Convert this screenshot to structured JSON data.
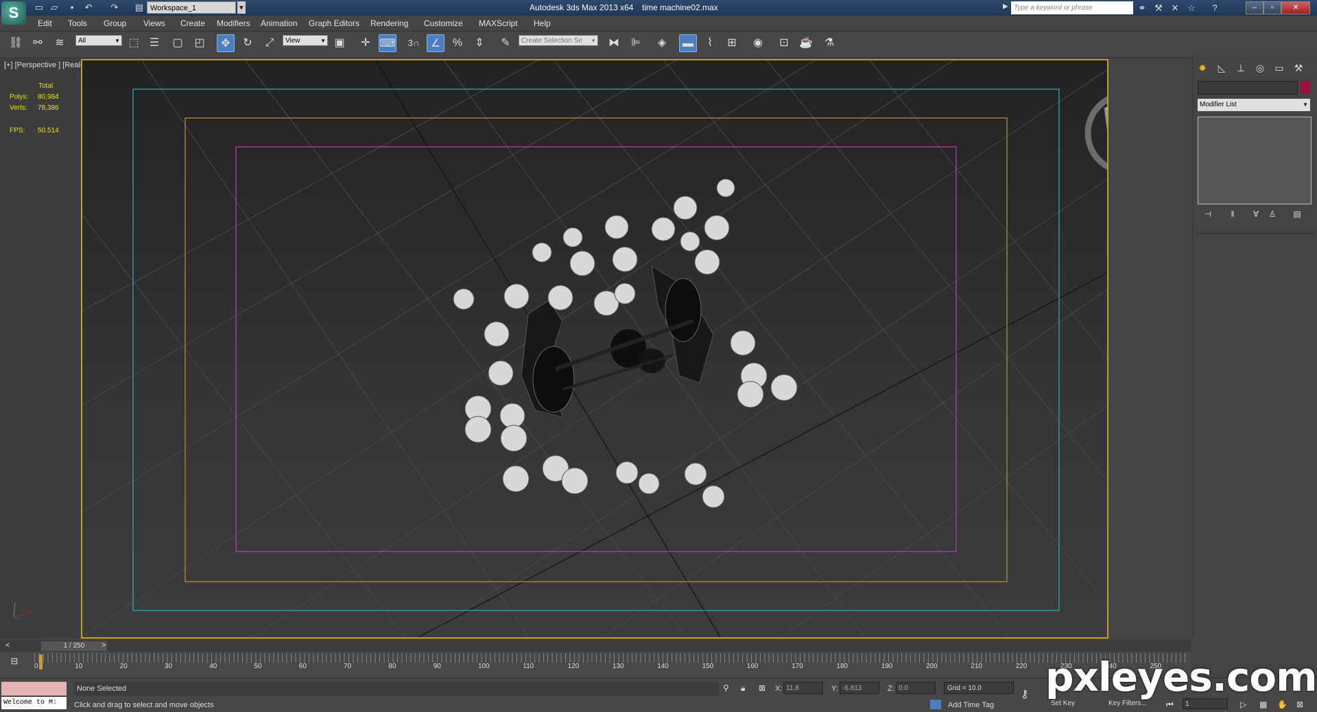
{
  "titlebar": {
    "workspace": "Workspace_1",
    "app_title": "Autodesk 3ds Max  2013 x64",
    "file_title": "time machine02.max",
    "search_placeholder": "Type a keyword or phrase"
  },
  "menu": [
    "Edit",
    "Tools",
    "Group",
    "Views",
    "Create",
    "Modifiers",
    "Animation",
    "Graph Editors",
    "Rendering",
    "Customize",
    "MAXScript",
    "Help"
  ],
  "toolbar": {
    "filter": "All",
    "ref_coord": "View",
    "selection_set": "Create Selection Se",
    "snap_label": "3"
  },
  "viewport": {
    "label": "[+] [Perspective ] [Realistic ]",
    "stats_header": "Total",
    "polys_label": "Polys:",
    "polys_value": "80,984",
    "verts_label": "Verts:",
    "verts_value": "78,386",
    "fps_label": "FPS:",
    "fps_value": "50.514",
    "viewcube_label": "TOP"
  },
  "command_panel": {
    "modifier_list": "Modifier List",
    "color_swatch": "#9b1040"
  },
  "timeline": {
    "frame_label": "1 / 250",
    "ticks": [
      "0",
      "10",
      "20",
      "30",
      "40",
      "50",
      "60",
      "70",
      "80",
      "90",
      "100",
      "110",
      "120",
      "130",
      "140",
      "150",
      "160",
      "170",
      "180",
      "190",
      "200",
      "210",
      "220",
      "230",
      "240",
      "250"
    ]
  },
  "status": {
    "listener_text": "Welcome to M:",
    "selection": "None Selected",
    "prompt": "Click and drag to select and move objects",
    "x_label": "X:",
    "x_value": "11.8",
    "y_label": "Y:",
    "y_value": "-6.813",
    "z_label": "Z:",
    "z_value": "0.0",
    "grid": "Grid = 10.0",
    "add_time_tag": "Add Time Tag",
    "set_key": "Set Key",
    "key_filters": "Key Filters...",
    "frame_field": "1"
  },
  "watermark": "pxleyes.com"
}
